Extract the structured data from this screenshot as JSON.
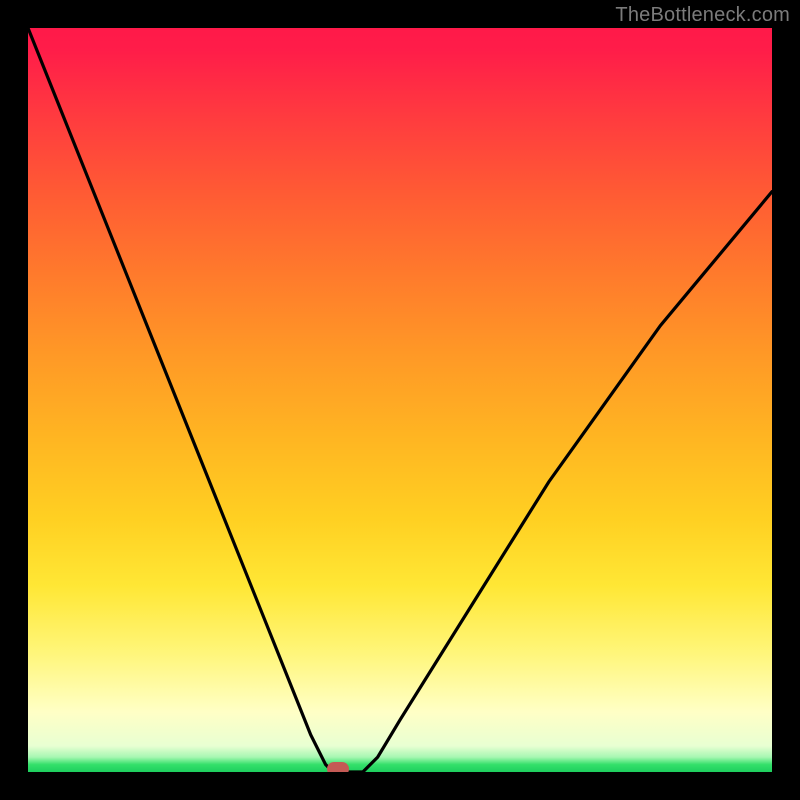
{
  "watermark": "TheBottleneck.com",
  "chart_data": {
    "type": "line",
    "title": "",
    "xlabel": "",
    "ylabel": "",
    "x": [
      0.0,
      0.04,
      0.08,
      0.12,
      0.16,
      0.2,
      0.24,
      0.28,
      0.32,
      0.36,
      0.38,
      0.4,
      0.41,
      0.42,
      0.43,
      0.44,
      0.45,
      0.47,
      0.5,
      0.55,
      0.6,
      0.65,
      0.7,
      0.75,
      0.8,
      0.85,
      0.9,
      0.95,
      1.0
    ],
    "y": [
      1.0,
      0.9,
      0.8,
      0.7,
      0.6,
      0.5,
      0.4,
      0.3,
      0.2,
      0.1,
      0.05,
      0.01,
      0.0,
      0.0,
      0.0,
      0.0,
      0.0,
      0.02,
      0.07,
      0.15,
      0.23,
      0.31,
      0.39,
      0.46,
      0.53,
      0.6,
      0.66,
      0.72,
      0.78
    ],
    "xlim": [
      0,
      1
    ],
    "ylim": [
      0,
      1
    ],
    "marker": {
      "x": 0.416,
      "y": 0.0
    },
    "background_gradient": {
      "top": "#ff1949",
      "mid": "#ffd022",
      "low": "#ffffc6",
      "bottom": "#1dcf5e"
    },
    "note": "x and y are normalized fractions of the plot area; the image has no axis ticks or labels, so values are estimated from geometry."
  }
}
